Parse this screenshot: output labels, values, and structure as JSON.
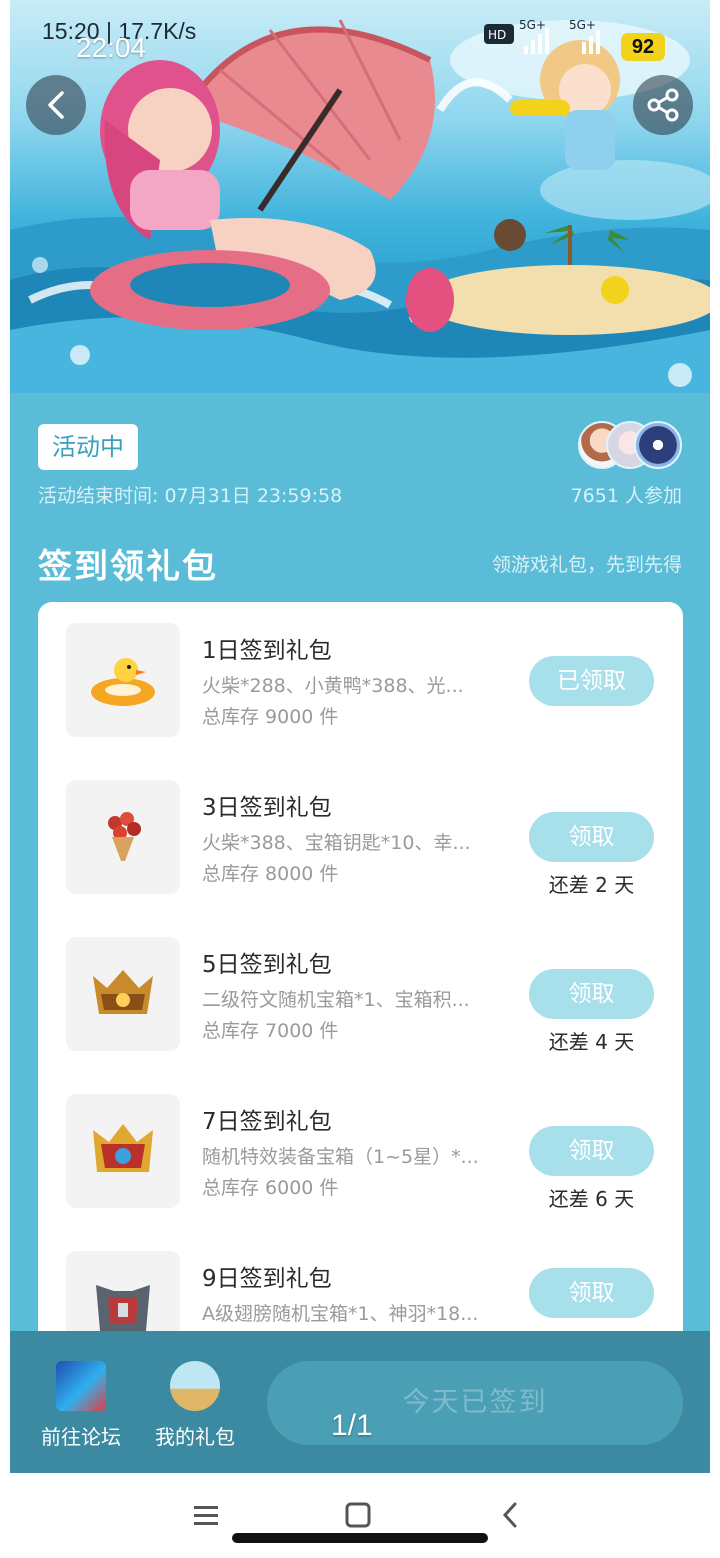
{
  "statusbar": {
    "time": "15:20 | 17.7K/s",
    "clock_overlay": "22:04",
    "network_1": "5G+",
    "network_2": "5G+",
    "battery": "92"
  },
  "header": {
    "back_icon": "back-arrow-icon",
    "share_icon": "share-icon"
  },
  "event": {
    "status_label": "活动中",
    "end_time": "活动结束时间: 07月31日 23:59:58",
    "participants": "7651 人参加"
  },
  "section": {
    "title": "签到领礼包",
    "subtitle": "领游戏礼包，先到先得"
  },
  "gifts": [
    {
      "name": "1日签到礼包",
      "desc": "火柴*288、小黄鸭*388、光...",
      "stock": "总库存 9000 件",
      "button": "已领取",
      "remain": "",
      "icon": "duck-float-icon"
    },
    {
      "name": "3日签到礼包",
      "desc": "火柴*388、宝箱钥匙*10、幸...",
      "stock": "总库存 8000 件",
      "button": "领取",
      "remain": "还差 2 天",
      "icon": "bouquet-icon"
    },
    {
      "name": "5日签到礼包",
      "desc": "二级符文随机宝箱*1、宝箱积...",
      "stock": "总库存 7000 件",
      "button": "领取",
      "remain": "还差 4 天",
      "icon": "golden-crown-icon"
    },
    {
      "name": "7日签到礼包",
      "desc": "随机特效装备宝箱（1~5星）*...",
      "stock": "总库存 6000 件",
      "button": "领取",
      "remain": "还差 6 天",
      "icon": "red-gold-crest-icon"
    },
    {
      "name": "9日签到礼包",
      "desc": "A级翅膀随机宝箱*1、神羽*18...",
      "stock": "",
      "button": "领取",
      "remain": "",
      "icon": "armor-chest-icon"
    }
  ],
  "bottombar": {
    "forum_label": "前往论坛",
    "mygift_label": "我的礼包",
    "signed_label": "今天已签到"
  },
  "page_indicator": "1/1",
  "colors": {
    "main_bg": "#5bbcd8",
    "button_bg": "#a7e0ea",
    "bottombar_bg": "#3c8aa1"
  }
}
